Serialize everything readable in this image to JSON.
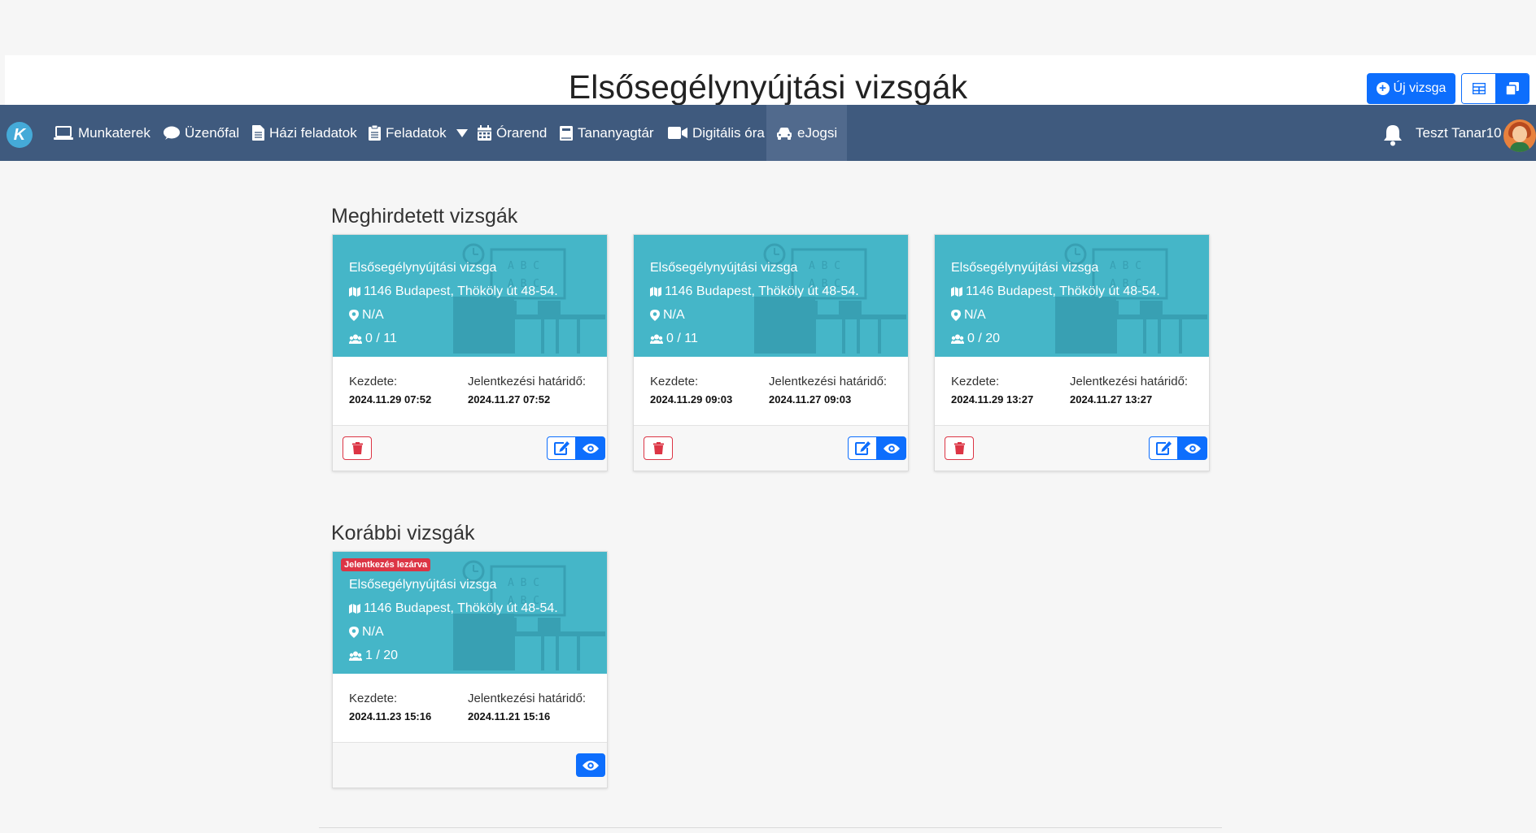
{
  "page": {
    "title": "Elsősegélynyújtási vizsgák"
  },
  "toolbar": {
    "new_exam_label": "Új vizsga",
    "view_grid_icon": "table-icon",
    "view_card_icon": "clone-icon"
  },
  "nav": {
    "logo_letter": "K",
    "items": [
      {
        "label": "Munkaterek",
        "icon": "laptop-icon"
      },
      {
        "label": "Üzenőfal",
        "icon": "comment-icon"
      },
      {
        "label": "Házi feladatok",
        "icon": "file-icon"
      },
      {
        "label": "Feladatok",
        "icon": "clipboard-icon"
      },
      {
        "label": "Órarend",
        "icon": "calendar-icon"
      },
      {
        "label": "Tananyagtár",
        "icon": "book-icon"
      },
      {
        "label": "Digitális óra",
        "icon": "video-icon"
      },
      {
        "label": "eJogsi",
        "icon": "car-icon"
      }
    ],
    "user_name": "Teszt Tanar10"
  },
  "sections": {
    "announced_title": "Meghirdetett vizsgák",
    "previous_title": "Korábbi vizsgák"
  },
  "labels": {
    "start": "Kezdete:",
    "deadline": "Jelentkezési határidő:"
  },
  "announced": [
    {
      "name": "Elsősegélynyújtási vizsga",
      "address": "1146 Budapest, Thököly út 48-54.",
      "room": "N/A",
      "count": "0 / 11",
      "start": "2024.11.29 07:52",
      "deadline": "2024.11.27 07:52"
    },
    {
      "name": "Elsősegélynyújtási vizsga",
      "address": "1146 Budapest, Thököly út 48-54.",
      "room": "N/A",
      "count": "0 / 11",
      "start": "2024.11.29 09:03",
      "deadline": "2024.11.27 09:03"
    },
    {
      "name": "Elsősegélynyújtási vizsga",
      "address": "1146 Budapest, Thököly út 48-54.",
      "room": "N/A",
      "count": "0 / 20",
      "start": "2024.11.29 13:27",
      "deadline": "2024.11.27 13:27"
    }
  ],
  "previous": [
    {
      "badge": "Jelentkezés lezárva",
      "name": "Elsősegélynyújtási vizsga",
      "address": "1146 Budapest, Thököly út 48-54.",
      "room": "N/A",
      "count": "1 / 20",
      "start": "2024.11.23 15:16",
      "deadline": "2024.11.21 15:16"
    }
  ],
  "colors": {
    "navbar": "#3f5a7e",
    "card_header": "#45b6c8",
    "primary": "#0d6efd",
    "danger": "#dc3545"
  }
}
